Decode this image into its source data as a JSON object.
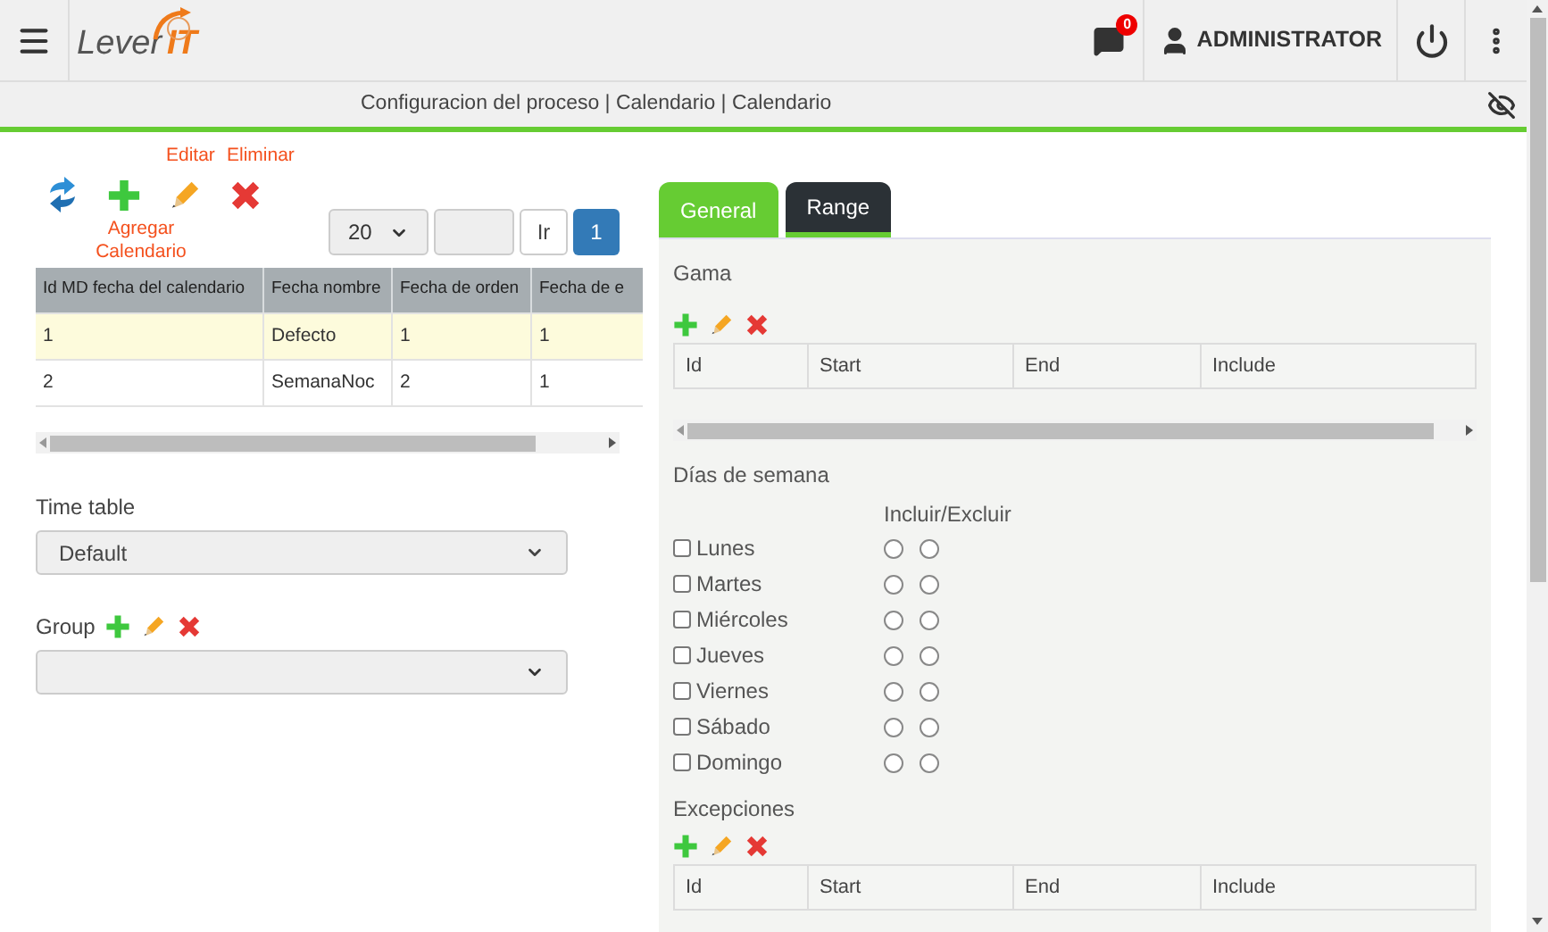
{
  "header": {
    "logo": {
      "word": "Lever",
      "accent": "IT"
    },
    "notifications": {
      "count": "0"
    },
    "user": "ADMINISTRATOR"
  },
  "breadcrumb": "Configuracion del proceso | Calendario | Calendario",
  "toolbar": [
    {
      "kind": "refresh"
    },
    {
      "kind": "add",
      "label_below": "Agregar Calendario"
    },
    {
      "kind": "edit",
      "label_above": "Editar"
    },
    {
      "kind": "delete",
      "label_above": "Eliminar"
    }
  ],
  "pagination": {
    "page_size": "20",
    "go_button": "Ir",
    "pages": [
      {
        "label": "1",
        "selected": true
      }
    ]
  },
  "table": {
    "columns": [
      "Id MD fecha del calendario",
      "Fecha nombre",
      "Fecha de orden",
      "Fecha de e"
    ],
    "rows": [
      {
        "cells": [
          "1",
          "Defecto",
          "1",
          "1"
        ],
        "selected": true
      },
      {
        "cells": [
          "2",
          "SemanaNoc",
          "2",
          "1"
        ],
        "selected": false
      }
    ]
  },
  "time_table": {
    "label": "Time table",
    "value": "Default"
  },
  "group": {
    "label": "Group"
  },
  "tabs": [
    {
      "label": "General",
      "selected": true
    },
    {
      "label": "Range",
      "selected": false
    }
  ],
  "gama": {
    "title": "Gama",
    "columns": [
      "Id",
      "Start",
      "End",
      "Include"
    ]
  },
  "weekdays": {
    "title": "Días de semana",
    "radio_heading": "Incluir/Excluir",
    "days": [
      {
        "name": "Lunes",
        "checked": false,
        "include": false,
        "exclude": false
      },
      {
        "name": "Martes",
        "checked": false,
        "include": false,
        "exclude": false
      },
      {
        "name": "Miércoles",
        "checked": false,
        "include": false,
        "exclude": false
      },
      {
        "name": "Jueves",
        "checked": false,
        "include": false,
        "exclude": false
      },
      {
        "name": "Viernes",
        "checked": false,
        "include": false,
        "exclude": false
      },
      {
        "name": "Sábado",
        "checked": false,
        "include": false,
        "exclude": false
      },
      {
        "name": "Domingo",
        "checked": false,
        "include": false,
        "exclude": false
      }
    ]
  },
  "exceptions": {
    "title": "Excepciones",
    "columns": [
      "Id",
      "Start",
      "End",
      "Include"
    ]
  }
}
